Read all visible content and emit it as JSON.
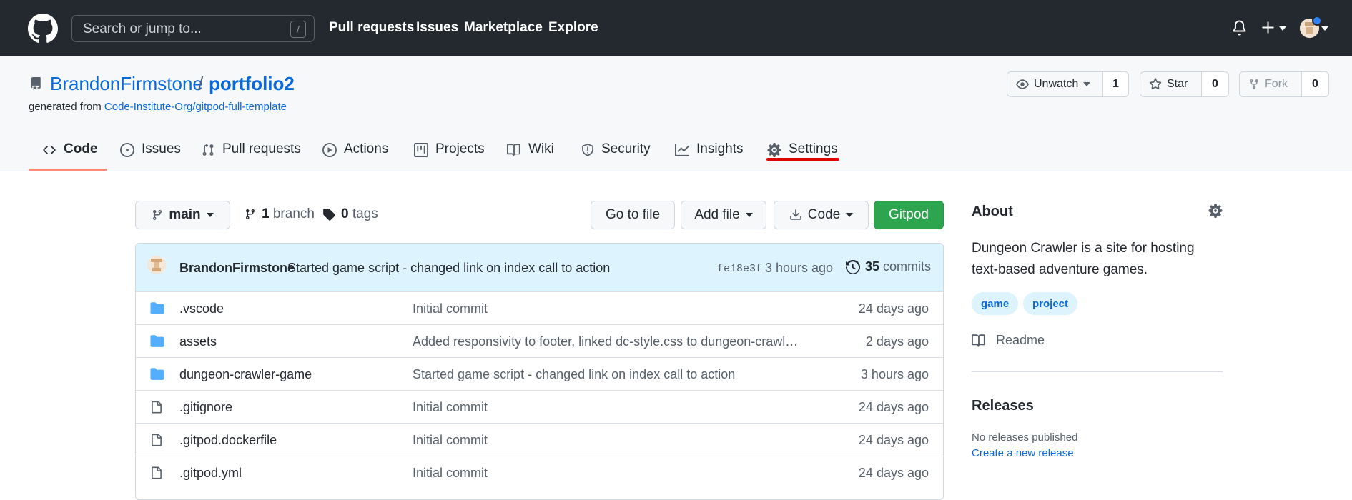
{
  "header": {
    "search_placeholder": "Search or jump to...",
    "search_shortcut": "/",
    "nav": [
      "Pull requests",
      "Issues",
      "Marketplace",
      "Explore"
    ]
  },
  "repo": {
    "owner": "BrandonFirmstone",
    "separator": "/",
    "name": "portfolio2",
    "generated_prefix": "generated from",
    "template": "Code-Institute-Org/gitpod-full-template",
    "watch_label": "Unwatch",
    "watch_count": "1",
    "star_label": "Star",
    "star_count": "0",
    "fork_label": "Fork",
    "fork_count": "0"
  },
  "tabs": [
    {
      "label": "Code",
      "icon": "code-icon",
      "selected": true
    },
    {
      "label": "Issues",
      "icon": "issue-icon"
    },
    {
      "label": "Pull requests",
      "icon": "pull-request-icon"
    },
    {
      "label": "Actions",
      "icon": "play-icon"
    },
    {
      "label": "Projects",
      "icon": "project-icon"
    },
    {
      "label": "Wiki",
      "icon": "book-icon"
    },
    {
      "label": "Security",
      "icon": "shield-icon"
    },
    {
      "label": "Insights",
      "icon": "graph-icon"
    },
    {
      "label": "Settings",
      "icon": "gear-icon"
    }
  ],
  "toolbar": {
    "branch": "main",
    "branch_count": "1",
    "branch_word": "branch",
    "tag_count": "0",
    "tag_word": "tags",
    "go_to_file": "Go to file",
    "add_file": "Add file",
    "code": "Code",
    "gitpod": "Gitpod"
  },
  "commit": {
    "author": "BrandonFirmstone",
    "message": "Started game script - changed link on index call to action",
    "sha": "fe18e3f",
    "time": "3 hours ago",
    "count": "35",
    "count_word": "commits"
  },
  "files": [
    {
      "type": "dir",
      "name": ".vscode",
      "message": "Initial commit",
      "age": "24 days ago"
    },
    {
      "type": "dir",
      "name": "assets",
      "message": "Added responsivity to footer, linked dc-style.css to dungeon-crawler-...",
      "age": "2 days ago"
    },
    {
      "type": "dir",
      "name": "dungeon-crawler-game",
      "message": "Started game script - changed link on index call to action",
      "age": "3 hours ago"
    },
    {
      "type": "file",
      "name": ".gitignore",
      "message": "Initial commit",
      "age": "24 days ago"
    },
    {
      "type": "file",
      "name": ".gitpod.dockerfile",
      "message": "Initial commit",
      "age": "24 days ago"
    },
    {
      "type": "file",
      "name": ".gitpod.yml",
      "message": "Initial commit",
      "age": "24 days ago"
    }
  ],
  "about": {
    "heading": "About",
    "description": "Dungeon Crawler is a site for hosting text-based adventure games.",
    "topics": [
      "game",
      "project"
    ],
    "readme": "Readme"
  },
  "releases": {
    "heading": "Releases",
    "none_text": "No releases published",
    "create_link": "Create a new release"
  },
  "colors": {
    "header_bg": "#24292f",
    "link": "#0969da",
    "green_button": "#2da44e",
    "selected_tab": "#fd8c73",
    "annotation_red": "#e00000",
    "commit_bar": "#ddf4ff",
    "folder": "#54aeff"
  }
}
